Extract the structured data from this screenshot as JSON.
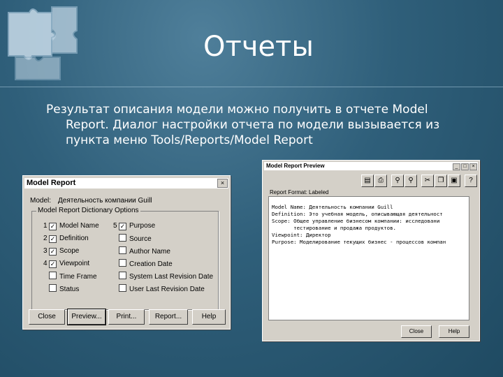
{
  "slide": {
    "title": "Отчеты",
    "body_line1": "Результат описания модели можно получить в отчете Model",
    "body_line2": "Report. Диалог настройки отчета по модели вызывается из",
    "body_line3": "пункта меню Tools/Reports/Model Report"
  },
  "model_report_dialog": {
    "title": "Model Report",
    "close_glyph": "×",
    "model_label": "Model:",
    "model_value": "Деятельность компании Guill",
    "group_label": "Model Report Dictionary Options",
    "options": [
      {
        "num": "1",
        "label": "Model Name",
        "checked": true
      },
      {
        "num": "2",
        "label": "Definition",
        "checked": true
      },
      {
        "num": "3",
        "label": "Scope",
        "checked": true
      },
      {
        "num": "4",
        "label": "Viewpoint",
        "checked": true
      },
      {
        "num": "",
        "label": "Time Frame",
        "checked": false
      },
      {
        "num": "",
        "label": "Status",
        "checked": false
      },
      {
        "num": "5",
        "label": "Purpose",
        "checked": true
      },
      {
        "num": "",
        "label": "Source",
        "checked": false
      },
      {
        "num": "",
        "label": "Author Name",
        "checked": false
      },
      {
        "num": "",
        "label": "Creation Date",
        "checked": false
      },
      {
        "num": "",
        "label": "System Last Revision Date",
        "checked": false
      },
      {
        "num": "",
        "label": "User Last Revision Date",
        "checked": false
      }
    ],
    "buttons": {
      "close": "Close",
      "preview": "Preview...",
      "print": "Print...",
      "report": "Report...",
      "help": "Help"
    }
  },
  "preview_window": {
    "title": "Model Report Preview",
    "controls": [
      "_",
      "□",
      "×"
    ],
    "format_label": "Report Format: Labeled",
    "report_lines": [
      "Model Name: Деятельность компании Guill",
      "Definition: Это учебная модель, описывающая деятельност",
      "Scope: Общее управление бизнесом компании: исследовани",
      "       тестирование и продажа продуктов.",
      "Viewpoint: Директор",
      "Purpose: Моделирование текущих бизнес - процессов компан"
    ],
    "toolbar_icons": [
      "save-icon",
      "print-icon",
      "find-icon",
      "find-next-icon",
      "cut-icon",
      "copy-icon",
      "paste-icon",
      "help-icon"
    ],
    "buttons": {
      "close": "Close",
      "help": "Help"
    }
  }
}
